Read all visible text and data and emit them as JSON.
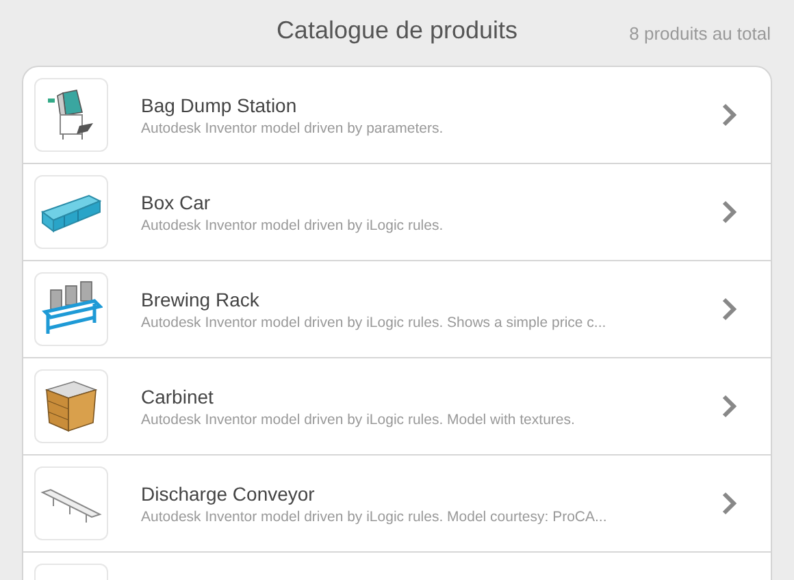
{
  "header": {
    "title": "Catalogue de produits",
    "count": "8 produits au total"
  },
  "products": [
    {
      "kind": "hopper",
      "name": "Bag Dump Station",
      "description": "Autodesk Inventor model driven by parameters."
    },
    {
      "kind": "railcar",
      "name": "Box Car",
      "description": "Autodesk Inventor model driven by iLogic rules."
    },
    {
      "kind": "rack",
      "name": "Brewing Rack",
      "description": "Autodesk Inventor model driven by iLogic rules. Shows a simple price c..."
    },
    {
      "kind": "cabinet",
      "name": "Carbinet",
      "description": "Autodesk Inventor model driven by iLogic rules. Model with textures."
    },
    {
      "kind": "conveyor",
      "name": "Discharge Conveyor",
      "description": "Autodesk Inventor model driven by iLogic rules. Model courtesy: ProCA..."
    }
  ]
}
